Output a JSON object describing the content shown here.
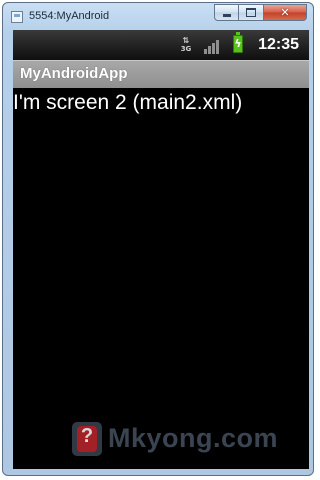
{
  "window": {
    "title": "5554:MyAndroid"
  },
  "status_bar": {
    "network_label": "3G",
    "time": "12:35",
    "signal_icon": "signal-bars-icon",
    "battery_icon": "battery-charging-icon",
    "battery_color": "#59c21a"
  },
  "app_bar": {
    "title": "MyAndroidApp"
  },
  "content": {
    "text": "I'm screen 2 (main2.xml)"
  },
  "watermark": {
    "text": "Mkyong.com",
    "logo_glyph": "?"
  }
}
